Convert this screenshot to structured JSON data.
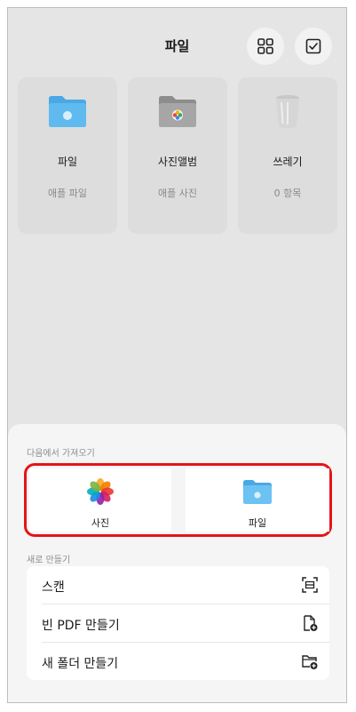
{
  "header": {
    "title": "파일"
  },
  "top_buttons": {
    "grid_icon": "grid-icon",
    "select_icon": "checkbox-icon"
  },
  "cards": [
    {
      "name": "파일",
      "subtitle": "애플 파일",
      "icon": "files-folder-icon"
    },
    {
      "name": "사진앨범",
      "subtitle": "애플 사진",
      "icon": "photos-folder-icon"
    },
    {
      "name": "쓰레기",
      "subtitle": "0 항목",
      "icon": "trash-icon"
    }
  ],
  "sheet": {
    "import_label": "다음에서 가져오기",
    "import_options": [
      {
        "label": "사진",
        "icon": "photos-icon"
      },
      {
        "label": "파일",
        "icon": "folder-icon"
      }
    ],
    "create_label": "새로 만들기",
    "create_items": [
      {
        "label": "스캔",
        "icon": "scan-icon"
      },
      {
        "label": "빈 PDF 만들기",
        "icon": "new-pdf-icon"
      },
      {
        "label": "새 폴더 만들기",
        "icon": "new-folder-icon"
      }
    ]
  },
  "colors": {
    "highlight": "#e3151a",
    "folder_blue": "#5bb5ec",
    "background": "#e5e5e5"
  }
}
